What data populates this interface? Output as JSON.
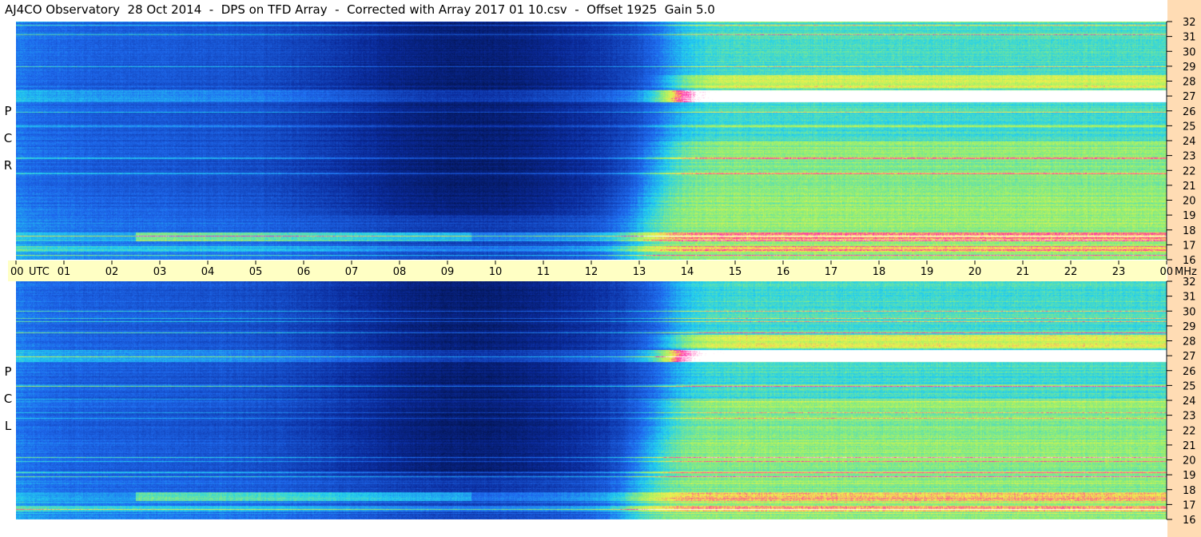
{
  "title": "AJ4CO Observatory  28 Oct 2014  -  DPS on TFD Array  -  Corrected with Array 2017 01 10.csv  -  Offset 1925  Gain 5.0",
  "chart_data": [
    {
      "type": "heatmap",
      "panel": "top",
      "polarization_label": [
        "R",
        "C",
        "P"
      ],
      "x": [
        "00",
        "01",
        "02",
        "03",
        "04",
        "05",
        "06",
        "07",
        "08",
        "09",
        "10",
        "11",
        "12",
        "13",
        "14",
        "15",
        "16",
        "17",
        "18",
        "19",
        "20",
        "21",
        "22",
        "23",
        "00"
      ],
      "xlabel": "UTC",
      "xlim": [
        0,
        24
      ],
      "y": [
        "16",
        "17",
        "18",
        "19",
        "20",
        "21",
        "22",
        "23",
        "24",
        "25",
        "26",
        "27",
        "28",
        "29",
        "30",
        "31",
        "32"
      ],
      "ylabel": "MHz",
      "ylim": [
        16,
        32
      ],
      "description_features": {
        "strong_signal_band_mhz": [
          26.6,
          27.4
        ],
        "quiet_night_utc": [
          0,
          13
        ],
        "day_onset_utc": 13.5
      }
    },
    {
      "type": "heatmap",
      "panel": "bottom",
      "polarization_label": [
        "L",
        "C",
        "P"
      ],
      "x": [
        "00",
        "01",
        "02",
        "03",
        "04",
        "05",
        "06",
        "07",
        "08",
        "09",
        "10",
        "11",
        "12",
        "13",
        "14",
        "15",
        "16",
        "17",
        "18",
        "19",
        "20",
        "21",
        "22",
        "23",
        "00"
      ],
      "xlim": [
        0,
        24
      ],
      "y": [
        "16",
        "17",
        "18",
        "19",
        "20",
        "21",
        "22",
        "23",
        "24",
        "25",
        "26",
        "27",
        "28",
        "29",
        "30",
        "31",
        "32"
      ],
      "ylim": [
        16,
        32
      ]
    }
  ],
  "colors": {
    "utc_bar": "#ffffc4",
    "right_strip": "#ffdcb4",
    "deep_night": "#000a30",
    "night": "#0a2a9a",
    "mid": "#1f6cf0",
    "cyan": "#22d0f0",
    "green": "#9ef06a",
    "yellow": "#f6f04a",
    "magenta": "#ff2aa8",
    "white": "#ffffff"
  }
}
